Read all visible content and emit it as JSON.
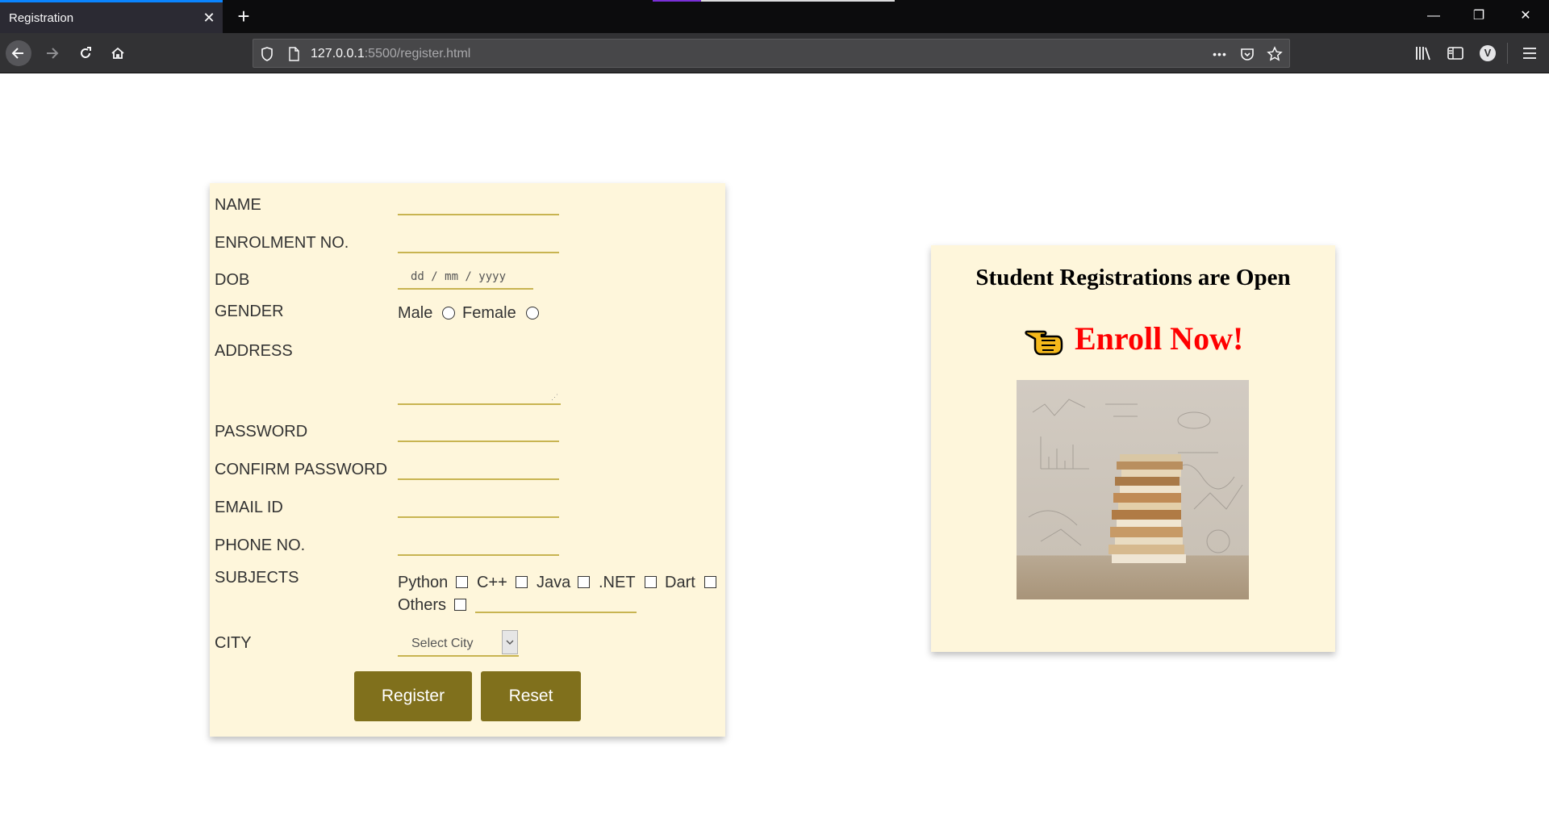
{
  "browser": {
    "tab_title": "Registration",
    "tab_close": "✕",
    "new_tab": "+",
    "url_host": "127.0.0.1",
    "url_rest": ":5500/register.html",
    "url_more": "•••",
    "profile_initial": "V",
    "window_controls": {
      "minimize": "—",
      "restore": "❐",
      "close": "✕"
    }
  },
  "form": {
    "labels": {
      "name": "NAME",
      "enrolment": "ENROLMENT NO.",
      "dob": "DOB",
      "gender": "GENDER",
      "address": "ADDRESS",
      "password": "PASSWORD",
      "confirm_password": "CONFIRM PASSWORD",
      "email": "EMAIL ID",
      "phone": "PHONE NO.",
      "subjects": "SUBJECTS",
      "city": "CITY"
    },
    "dob_placeholder": "dd / mm / yyyy",
    "gender_options": {
      "male": "Male",
      "female": "Female"
    },
    "subjects": {
      "python": "Python",
      "cpp": "C++",
      "java": "Java",
      "dotnet": ".NET",
      "dart": "Dart",
      "others": "Others"
    },
    "city_selected": "Select City",
    "register_label": "Register",
    "reset_label": "Reset"
  },
  "promo": {
    "title": "Student Registrations are Open",
    "cta": "Enroll Now!"
  },
  "colors": {
    "card_bg": "#fef6db",
    "underline": "#c8b451",
    "button_bg": "#80701c",
    "cta": "#ff0000"
  }
}
